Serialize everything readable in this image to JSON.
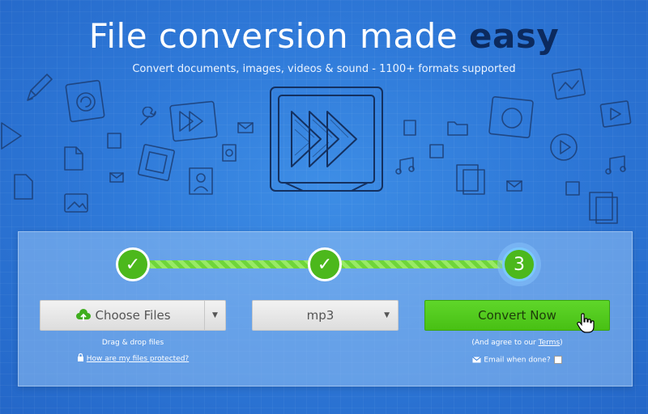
{
  "hero": {
    "title_main": "File conversion made ",
    "title_emph": "easy",
    "subtitle": "Convert documents, images, videos & sound - 1100+ formats supported"
  },
  "steps": [
    {
      "state": "done",
      "label": "✓"
    },
    {
      "state": "done",
      "label": "✓"
    },
    {
      "state": "current",
      "label": "3"
    }
  ],
  "choose": {
    "label": "Choose Files",
    "caption": "Drag & drop files",
    "protect_link": "How are my files protected?"
  },
  "format": {
    "selected": "mp3"
  },
  "convert": {
    "label": "Convert Now",
    "terms_prefix": "(And agree to our ",
    "terms_link": "Terms",
    "terms_suffix": ")",
    "email_label": "Email when done?"
  },
  "colors": {
    "background": "#2f7ad9",
    "accent_green": "#4cb81c",
    "title_emphasis": "#0c2a5e"
  },
  "icons": [
    "pencil-icon",
    "file-icon",
    "play-forward-icon",
    "music-note-icon",
    "envelope-icon",
    "folder-icon",
    "clipboard-icon",
    "wrench-icon",
    "cloud-upload-icon",
    "lock-icon",
    "mail-icon",
    "caret-down-icon",
    "cursor-hand-icon"
  ]
}
